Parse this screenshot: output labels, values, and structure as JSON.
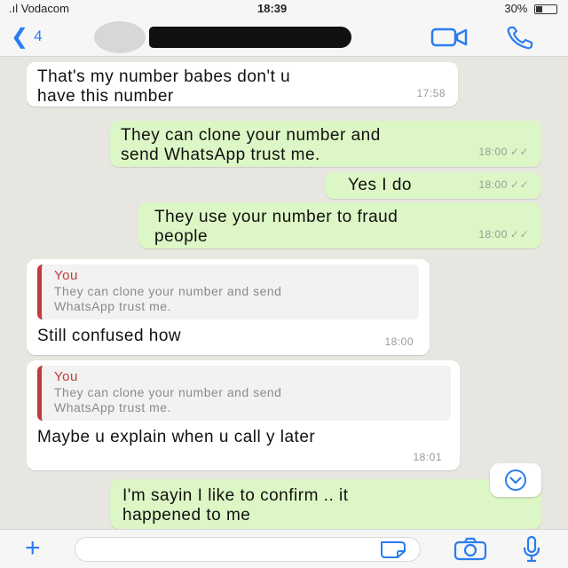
{
  "status_bar": {
    "carrier": ".ıl Vodacom",
    "wifi": "wifi-icon",
    "time": "18:39",
    "battery": "30%"
  },
  "header": {
    "back_count": "4",
    "accent": "#2a7df0"
  },
  "messages": [
    {
      "dir": "in",
      "text_line1": "That's my number babes don't u",
      "text_line2": "have this number",
      "time": "17:58"
    },
    {
      "dir": "out",
      "text_line1": "They can clone your number and",
      "text_line2": "send WhatsApp trust me.",
      "time": "18:00"
    },
    {
      "dir": "out",
      "text_line1": "Yes I do",
      "time": "18:00"
    },
    {
      "dir": "out",
      "text_line1": "They use your number to fraud",
      "text_line2": "people",
      "time": "18:00"
    },
    {
      "dir": "in",
      "quote_author": "You",
      "quote_line1": "They can clone your number and send",
      "quote_line2": "WhatsApp trust me.",
      "text_line1": "Still confused how",
      "time": "18:00"
    },
    {
      "dir": "in",
      "quote_author": "You",
      "quote_line1": "They can clone your number and send",
      "quote_line2": "WhatsApp trust me.",
      "text_line1": "Maybe u explain when u call y later",
      "time": "18:01"
    },
    {
      "dir": "out",
      "text_line1": "I'm sayin I like to confirm .. it",
      "text_line2": "happened to me"
    }
  ],
  "colors": {
    "incoming": "#ffffff",
    "outgoing": "#dcf7c5",
    "quote_accent": "#c33a3a",
    "background": "#e8e6e1"
  }
}
